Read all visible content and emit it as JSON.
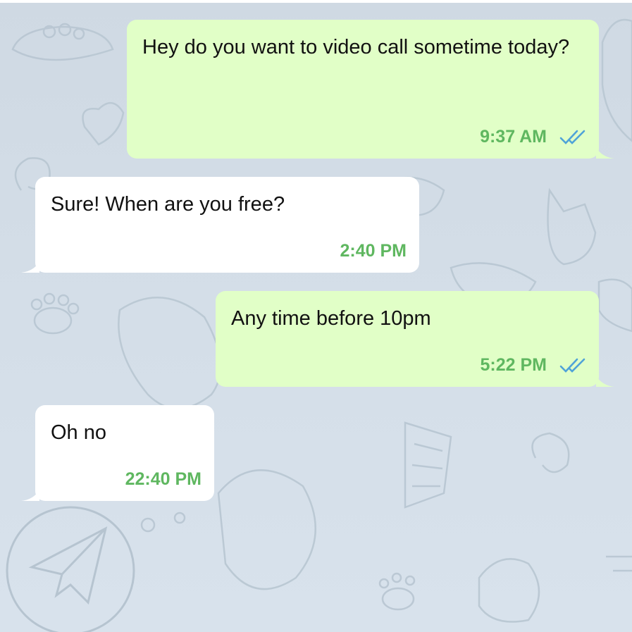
{
  "chat": {
    "messages": [
      {
        "direction": "outgoing",
        "text": "Hey do you want to video call sometime today?",
        "time": "9:37 AM",
        "status": "read"
      },
      {
        "direction": "incoming",
        "text": "Sure! When are you free?",
        "time": "2:40 PM"
      },
      {
        "direction": "outgoing",
        "text": "Any time before 10pm",
        "time": "5:22 PM",
        "status": "read"
      },
      {
        "direction": "incoming",
        "text": "Oh no",
        "time": "22:40 PM"
      }
    ]
  },
  "icons": {
    "read_status": "double-check-icon",
    "background_logo": "paper-plane-icon"
  },
  "colors": {
    "outgoing_bubble": "#e1ffc7",
    "incoming_bubble": "#ffffff",
    "time_text": "#5fb760",
    "check_marks": "#4fa3d8",
    "chat_background": "#d3dde6"
  }
}
